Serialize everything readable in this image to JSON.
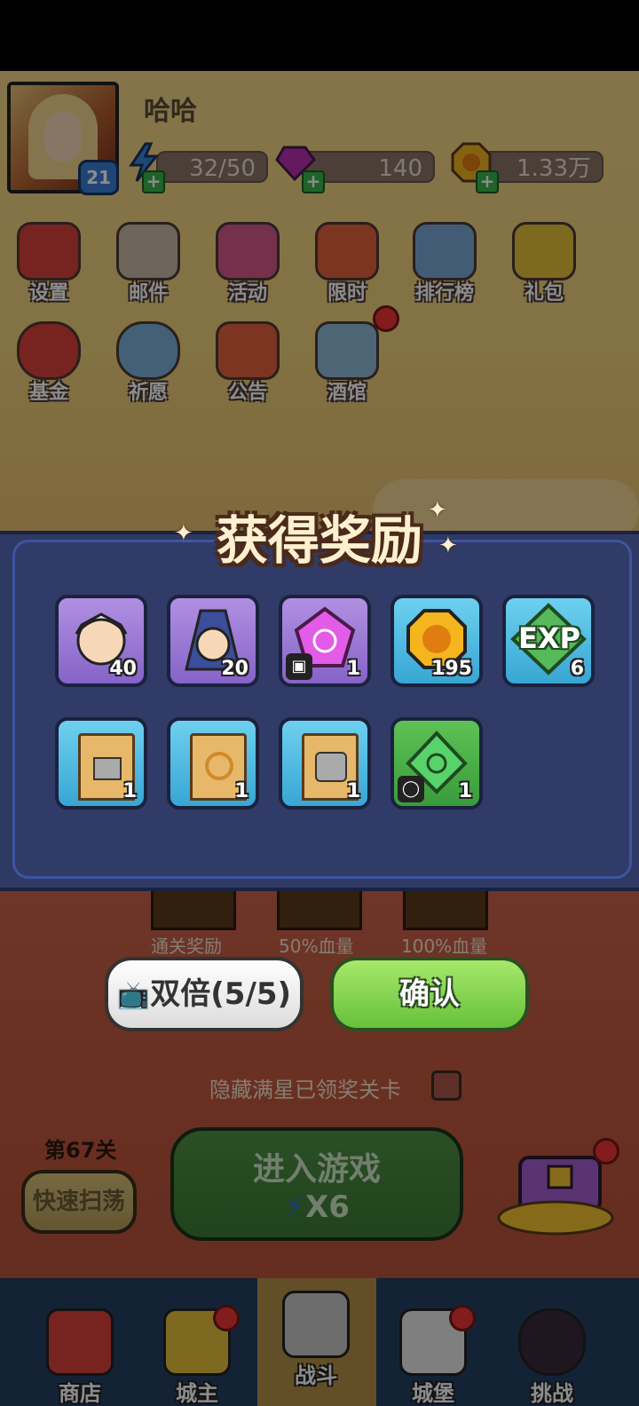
{
  "player": {
    "name": "哈哈",
    "level": "21"
  },
  "resources": [
    {
      "icon": "energy-icon",
      "value": "32/50"
    },
    {
      "icon": "gem-icon",
      "value": "140"
    },
    {
      "icon": "coin-icon",
      "value": "1.33万"
    }
  ],
  "menu_row1": [
    {
      "icon": "gear-icon",
      "label": "设置"
    },
    {
      "icon": "mail-icon",
      "label": "邮件"
    },
    {
      "icon": "event-icon",
      "label": "活动"
    },
    {
      "icon": "clock-icon",
      "label": "限时"
    },
    {
      "icon": "leaderboard-icon",
      "label": "排行榜"
    },
    {
      "icon": "gift-icon",
      "label": "礼包"
    }
  ],
  "menu_row2": [
    {
      "icon": "fund-bag-icon",
      "label": "基金"
    },
    {
      "icon": "wish-icon",
      "label": "祈愿"
    },
    {
      "icon": "megaphone-icon",
      "label": "公告"
    },
    {
      "icon": "tavern-mug-icon",
      "label": "酒馆"
    }
  ],
  "reward_dialog": {
    "title": "获得奖励",
    "items_row1": [
      {
        "icon": "hero-warrior-shard-icon",
        "qty": "40",
        "bg": "purple"
      },
      {
        "icon": "hero-mage-shard-icon",
        "qty": "20",
        "bg": "purple"
      },
      {
        "icon": "purple-gem-icon",
        "qty": "1",
        "bg": "purple"
      },
      {
        "icon": "gold-coin-icon",
        "qty": "195",
        "bg": "blue"
      },
      {
        "icon": "exp-icon",
        "qty": "6",
        "bg": "blue",
        "text": "EXP"
      }
    ],
    "items_row2": [
      {
        "icon": "boot-scroll-icon",
        "qty": "1",
        "bg": "blue"
      },
      {
        "icon": "ring-scroll-icon",
        "qty": "1",
        "bg": "blue"
      },
      {
        "icon": "armor-scroll-icon",
        "qty": "1",
        "bg": "blue"
      },
      {
        "icon": "green-gem-icon",
        "qty": "1",
        "bg": "green"
      }
    ],
    "double_button": "双倍(5/5)",
    "confirm_button": "确认"
  },
  "stage": {
    "chest_labels": [
      "通关奖励",
      "50%血量",
      "100%血量"
    ],
    "hide_text": "隐藏满星已领奖关卡",
    "level_label": "第67关",
    "sweep_button": "快速扫荡",
    "enter_button": "进入游戏",
    "cost": "X6"
  },
  "nav": [
    {
      "icon": "shop-icon",
      "label": "商店"
    },
    {
      "icon": "crown-icon",
      "label": "城主"
    },
    {
      "icon": "crossed-swords-icon",
      "label": "战斗"
    },
    {
      "icon": "castle-icon",
      "label": "城堡"
    },
    {
      "icon": "demon-icon",
      "label": "挑战"
    }
  ],
  "colors": {
    "panel": "#2f3a64",
    "confirm_green": "#67c13a",
    "nav_bg": "#263e63",
    "nav_active": "#b59147"
  }
}
